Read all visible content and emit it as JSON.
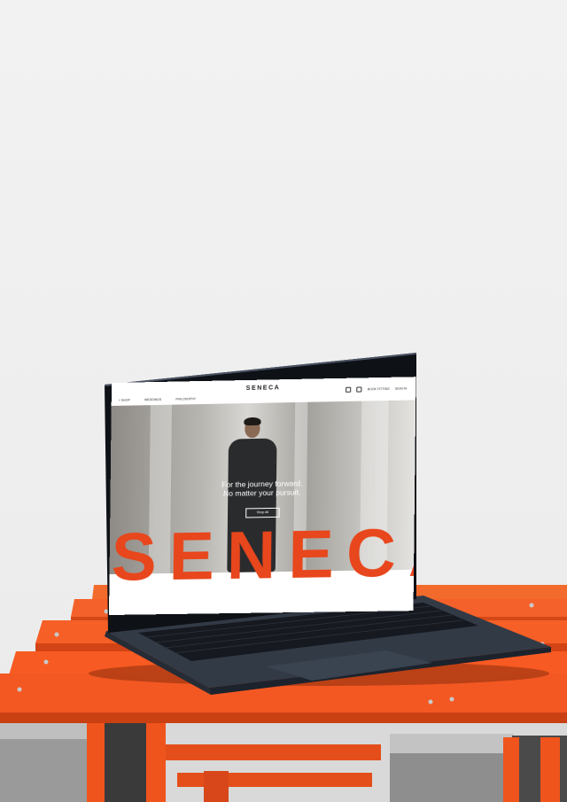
{
  "website": {
    "brand": "SENECA",
    "nav": [
      "+ SHOP",
      "WEDDINGS",
      "PHILOSOPHY"
    ],
    "nav_right": [
      "BOOK FITTING",
      "SIGN IN"
    ],
    "hero_line_1": "For the journey forward.",
    "hero_line_2": "No matter your pursuit.",
    "hero_button": "Shop All",
    "big_word": "SENECA"
  },
  "colors": {
    "accent_orange": "#e8461c",
    "bench_orange": "#f2561d",
    "laptop_body": "#2d3440",
    "background": "#efefef"
  }
}
